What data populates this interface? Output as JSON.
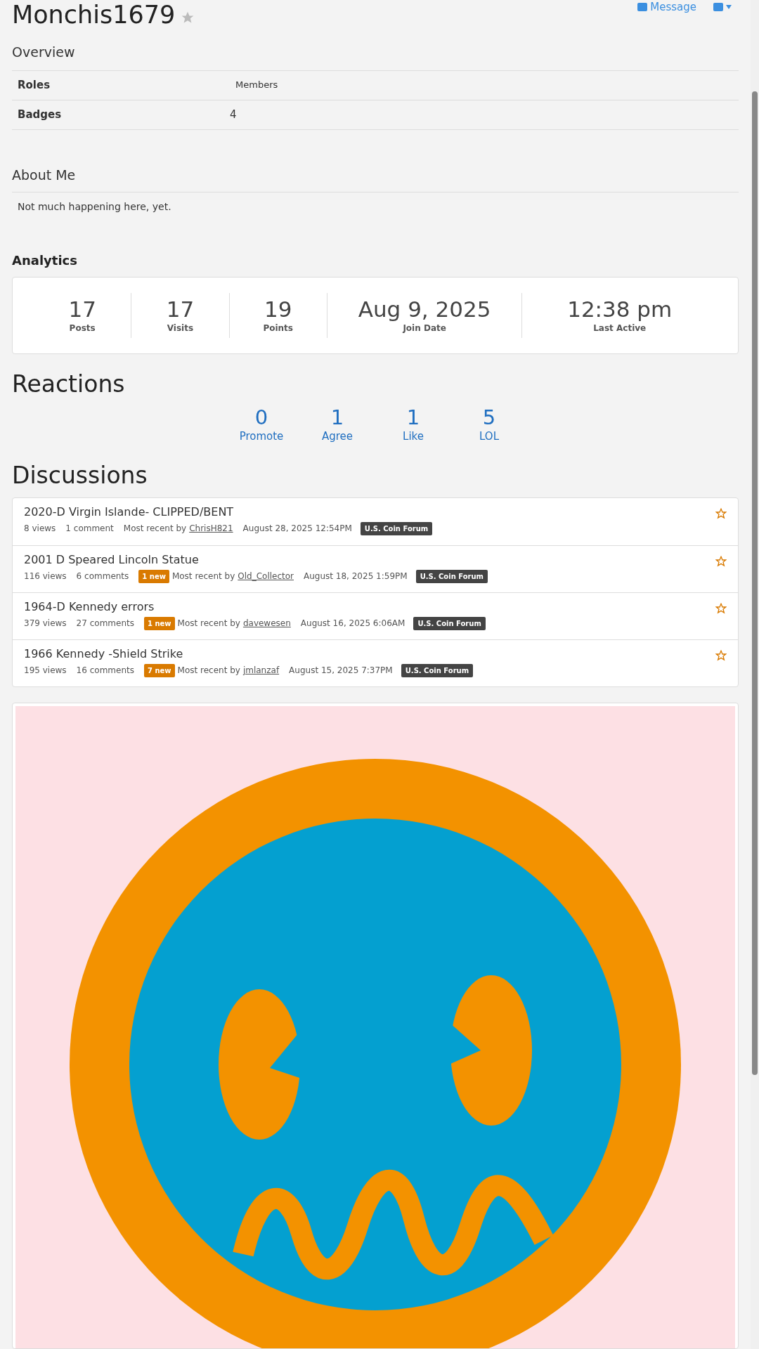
{
  "profile": {
    "username": "Monchis1679",
    "actions": [
      "Message"
    ]
  },
  "overview": {
    "title": "Overview",
    "rows": [
      {
        "label": "Roles",
        "value": "Members"
      },
      {
        "label": "Badges",
        "value": "4"
      }
    ]
  },
  "about": {
    "title": "About Me",
    "text": "Not much happening here, yet."
  },
  "analytics": {
    "title": "Analytics",
    "stats": [
      {
        "value": "17",
        "label": "Posts"
      },
      {
        "value": "17",
        "label": "Visits"
      },
      {
        "value": "19",
        "label": "Points"
      },
      {
        "value": "Aug 9, 2025",
        "label": "Join Date"
      },
      {
        "value": "12:38 pm",
        "label": "Last Active"
      }
    ]
  },
  "reactions": {
    "title": "Reactions",
    "items": [
      {
        "count": "0",
        "label": "Promote"
      },
      {
        "count": "1",
        "label": "Agree"
      },
      {
        "count": "1",
        "label": "Like"
      },
      {
        "count": "5",
        "label": "LOL"
      }
    ]
  },
  "discussions": {
    "title": "Discussions",
    "items": [
      {
        "title": "2020-D Virgin Islande- CLIPPED/BENT",
        "views": "8 views",
        "comments": "1 comment",
        "recent_prefix": "Most recent by",
        "recent_user": "ChrisH821",
        "date": "August 28, 2025 12:54PM",
        "category": "U.S. Coin Forum"
      },
      {
        "title": "2001 D Speared Lincoln Statue",
        "views": "116 views",
        "comments": "6 comments",
        "new": "1 new",
        "recent_prefix": "Most recent by",
        "recent_user": "Old_Collector",
        "date": "August 18, 2025 1:59PM",
        "category": "U.S. Coin Forum"
      },
      {
        "title": "1964-D Kennedy errors",
        "views": "379 views",
        "comments": "27 comments",
        "new": "1 new",
        "recent_prefix": "Most recent by",
        "recent_user": "davewesen",
        "date": "August 16, 2025 6:06AM",
        "category": "U.S. Coin Forum"
      },
      {
        "title": "1966 Kennedy -Shield Strike",
        "views": "195 views",
        "comments": "16 comments",
        "new": "7 new",
        "recent_prefix": "Most recent by",
        "recent_user": "jmlanzaf",
        "date": "August 15, 2025 7:37PM",
        "category": "U.S. Coin Forum"
      }
    ]
  }
}
